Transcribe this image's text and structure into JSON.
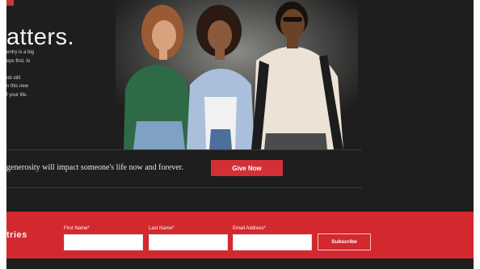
{
  "hero": {
    "headline": "atters.",
    "paragraphs": [
      "entry is a big\neps first, to",
      "ob still\nn this new\nf your life."
    ]
  },
  "cta": {
    "text": "generosity will impact someone's life now and forever.",
    "button_label": "Give Now"
  },
  "signup": {
    "title": "tries",
    "first_name_label": "First Name*",
    "last_name_label": "Last Name*",
    "email_label": "Email Address*",
    "subscribe_label": "Subscribe"
  },
  "colors": {
    "brand_red": "#d4282f",
    "dark_bg": "#1e1e1e"
  }
}
